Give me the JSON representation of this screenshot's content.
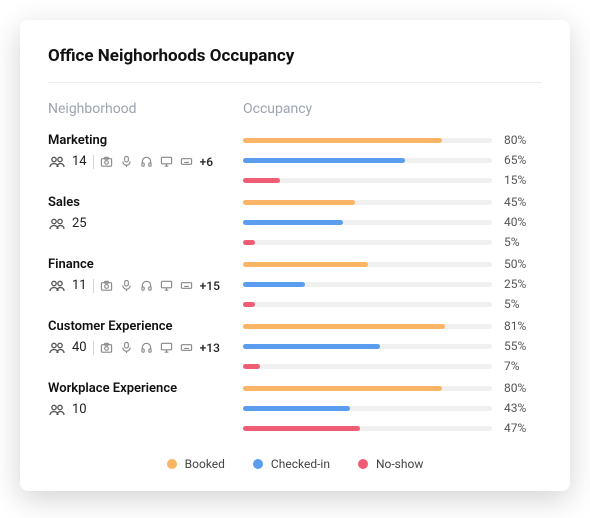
{
  "title": "Office Neighorhoods Occupancy",
  "columns": {
    "left": "Neighborhood",
    "right": "Occupancy"
  },
  "colors": {
    "booked": "#f9b565",
    "checked_in": "#5a9ced",
    "no_show": "#ef5d74",
    "track": "#f0f0f0"
  },
  "legend": [
    {
      "key": "booked",
      "label": "Booked"
    },
    {
      "key": "checked_in",
      "label": "Checked-in"
    },
    {
      "key": "no_show",
      "label": "No-show"
    }
  ],
  "neighborhoods": [
    {
      "name": "Marketing",
      "people": 14,
      "amenities_shown": 5,
      "amenities_extra": "+6",
      "bars": {
        "booked": 80,
        "checked_in": 65,
        "no_show": 15
      }
    },
    {
      "name": "Sales",
      "people": 25,
      "amenities_shown": 0,
      "amenities_extra": null,
      "bars": {
        "booked": 45,
        "checked_in": 40,
        "no_show": 5
      }
    },
    {
      "name": "Finance",
      "people": 11,
      "amenities_shown": 5,
      "amenities_extra": "+15",
      "bars": {
        "booked": 50,
        "checked_in": 25,
        "no_show": 5
      }
    },
    {
      "name": "Customer Experience",
      "people": 40,
      "amenities_shown": 5,
      "amenities_extra": "+13",
      "bars": {
        "booked": 81,
        "checked_in": 55,
        "no_show": 7
      }
    },
    {
      "name": "Workplace Experience",
      "people": 10,
      "amenities_shown": 0,
      "amenities_extra": null,
      "bars": {
        "booked": 80,
        "checked_in": 43,
        "no_show": 47
      }
    }
  ],
  "chart_data": {
    "type": "bar",
    "title": "Office Neighorhoods Occupancy",
    "xlabel": "Occupancy",
    "ylabel": "Neighborhood",
    "xlim": [
      0,
      100
    ],
    "categories": [
      "Marketing",
      "Sales",
      "Finance",
      "Customer Experience",
      "Workplace Experience"
    ],
    "series": [
      {
        "name": "Booked",
        "values": [
          80,
          45,
          50,
          81,
          80
        ]
      },
      {
        "name": "Checked-in",
        "values": [
          65,
          40,
          25,
          55,
          43
        ]
      },
      {
        "name": "No-show",
        "values": [
          15,
          5,
          5,
          7,
          47
        ]
      }
    ]
  }
}
